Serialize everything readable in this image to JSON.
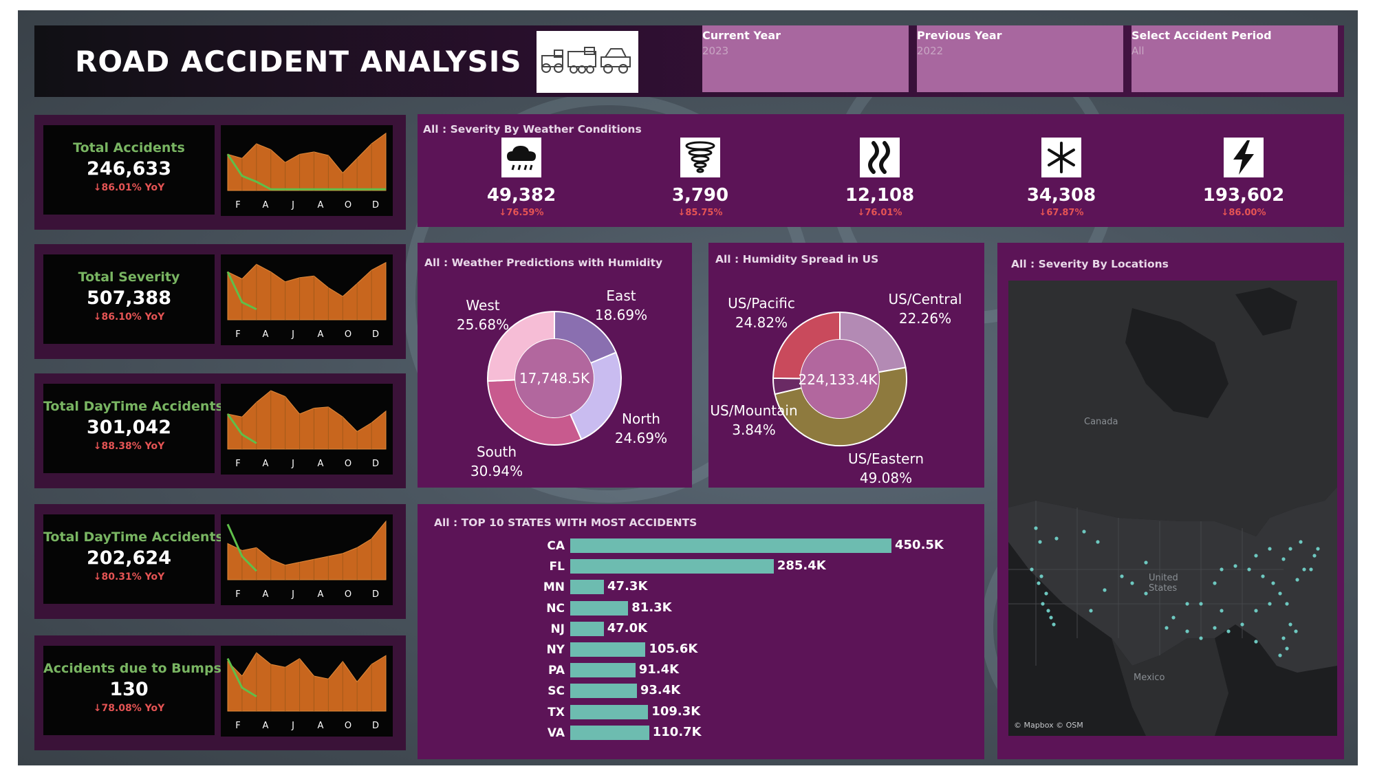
{
  "header": {
    "title": "ROAD ACCIDENT ANALYSIS",
    "logo_icon": "vehicles-icon",
    "filters": [
      {
        "label": "Current Year",
        "value": "2023"
      },
      {
        "label": "Previous Year",
        "value": "2022"
      },
      {
        "label": "Select Accident Period",
        "value": "All"
      }
    ]
  },
  "kpis": [
    {
      "label": "Total Accidents",
      "value": "246,633",
      "yoy": "↓86.01% YoY",
      "months": [
        "F",
        "A",
        "J",
        "A",
        "O",
        "D"
      ],
      "current": [
        0.62,
        0.55,
        0.8,
        0.7,
        0.48,
        0.62,
        0.66,
        0.6,
        0.3,
        0.55,
        0.8,
        0.98
      ],
      "previous": [
        0.62,
        0.25,
        0.15,
        0.02,
        0.02,
        0.02,
        0.02,
        0.02,
        0.02,
        0.02,
        0.02,
        0.02
      ]
    },
    {
      "label": "Total Severity",
      "value": "507,388",
      "yoy": "↓86.10% YoY",
      "months": [
        "F",
        "A",
        "J",
        "A",
        "O",
        "D"
      ],
      "current": [
        0.82,
        0.7,
        0.95,
        0.82,
        0.65,
        0.72,
        0.75,
        0.55,
        0.4,
        0.62,
        0.85,
        0.98
      ],
      "previous": [
        0.82,
        0.3,
        0.18
      ]
    },
    {
      "label": "Total DayTime Accidents",
      "value": "301,042",
      "yoy": "↓88.38% YoY",
      "months": [
        "F",
        "A",
        "J",
        "A",
        "O",
        "D"
      ],
      "current": [
        0.6,
        0.55,
        0.8,
        1.0,
        0.9,
        0.6,
        0.7,
        0.72,
        0.55,
        0.3,
        0.45,
        0.65
      ],
      "previous": [
        0.6,
        0.25,
        0.1
      ]
    },
    {
      "label": "Total DayTime Accidents",
      "value": "202,624",
      "yoy": "↓80.31% YoY",
      "months": [
        "F",
        "A",
        "J",
        "A",
        "O",
        "D"
      ],
      "current": [
        0.62,
        0.5,
        0.55,
        0.35,
        0.25,
        0.3,
        0.35,
        0.4,
        0.45,
        0.55,
        0.7,
        1.0
      ],
      "previous": [
        0.95,
        0.4,
        0.15
      ]
    },
    {
      "label": "Accidents due to Bumps",
      "value": "130",
      "yoy": "↓78.08% YoY",
      "months": [
        "F",
        "A",
        "J",
        "A",
        "O",
        "D"
      ],
      "current": [
        0.85,
        0.6,
        1.0,
        0.8,
        0.75,
        0.9,
        0.6,
        0.55,
        0.85,
        0.5,
        0.8,
        0.95
      ],
      "previous": [
        0.9,
        0.4,
        0.25
      ]
    }
  ],
  "weather": {
    "title": "All : Severity By Weather Conditions",
    "items": [
      {
        "icon": "rain-cloud-icon",
        "value": "49,382",
        "pct": "↓76.59%"
      },
      {
        "icon": "tornado-icon",
        "value": "3,790",
        "pct": "↓85.75%"
      },
      {
        "icon": "smoke-icon",
        "value": "12,108",
        "pct": "↓76.01%"
      },
      {
        "icon": "snowflake-icon",
        "value": "34,308",
        "pct": "↓67.87%"
      },
      {
        "icon": "lightning-icon",
        "value": "193,602",
        "pct": "↓86.00%"
      }
    ]
  },
  "chart_data": [
    {
      "type": "pie",
      "title": "All : Weather Predictions with Humidity",
      "center_label": "17,748.5K",
      "slices": [
        {
          "label": "East",
          "pct": "18.69%",
          "value": 18.69,
          "color": "#8a6fb0"
        },
        {
          "label": "North",
          "pct": "24.69%",
          "value": 24.69,
          "color": "#c9bcf0"
        },
        {
          "label": "South",
          "pct": "30.94%",
          "value": 30.94,
          "color": "#c85a8e"
        },
        {
          "label": "West",
          "pct": "25.68%",
          "value": 25.68,
          "color": "#f6bdd6"
        }
      ]
    },
    {
      "type": "pie",
      "title": "All : Humidity Spread in US",
      "center_label": "224,133.4K",
      "slices": [
        {
          "label": "US/Central",
          "pct": "22.26%",
          "value": 22.26,
          "color": "#b38ab4"
        },
        {
          "label": "US/Eastern",
          "pct": "49.08%",
          "value": 49.08,
          "color": "#8e7a3e"
        },
        {
          "label": "US/Mountain",
          "pct": "3.84%",
          "value": 3.84,
          "color": "#6a2a64"
        },
        {
          "label": "US/Pacific",
          "pct": "24.82%",
          "value": 24.82,
          "color": "#c94a5c"
        }
      ]
    },
    {
      "type": "bar",
      "orientation": "horizontal",
      "title": "All : TOP 10 STATES WITH MOST ACCIDENTS",
      "categories": [
        "CA",
        "FL",
        "MN",
        "NC",
        "NJ",
        "NY",
        "PA",
        "SC",
        "TX",
        "VA"
      ],
      "values": [
        450.5,
        285.4,
        47.3,
        81.3,
        47.0,
        105.6,
        91.4,
        93.4,
        109.3,
        110.7
      ],
      "labels": [
        "450.5K",
        "285.4K",
        "47.3K",
        "81.3K",
        "47.0K",
        "105.6K",
        "91.4K",
        "93.4K",
        "109.3K",
        "110.7K"
      ],
      "color": "#6dbcb0"
    }
  ],
  "map": {
    "title": "All : Severity By Locations",
    "labels": {
      "canada": "Canada",
      "us": "United States",
      "mexico": "Mexico"
    },
    "attribution": "© Mapbox © OSM"
  },
  "colors": {
    "series_current": "#c8661e",
    "series_previous": "#5fbf4a",
    "bar": "#6dbcb0"
  }
}
